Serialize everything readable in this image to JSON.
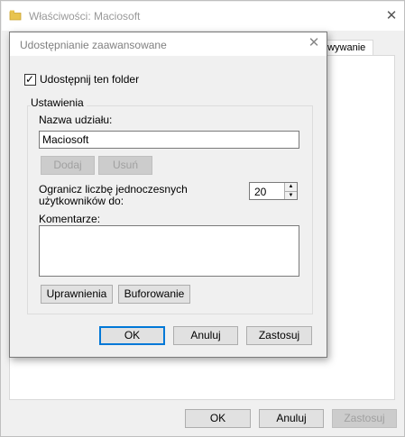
{
  "background_window": {
    "title": "Właściwości: Maciosoft",
    "tab_label": "owywanie",
    "buttons": {
      "ok": "OK",
      "cancel": "Anuluj",
      "apply": "Zastosuj"
    }
  },
  "dialog": {
    "title": "Udostępnianie zaawansowane",
    "share_checkbox": {
      "label": "Udostępnij ten folder",
      "checked": true
    },
    "settings_group": {
      "legend": "Ustawienia",
      "share_name_label": "Nazwa udziału:",
      "share_name_value": "Maciosoft",
      "add_button": "Dodaj",
      "remove_button": "Usuń",
      "limit_label": "Ogranicz liczbę jednoczesnych użytkowników do:",
      "limit_value": "20",
      "comments_label": "Komentarze:",
      "comments_value": "",
      "permissions_button": "Uprawnienia",
      "caching_button": "Buforowanie"
    },
    "buttons": {
      "ok": "OK",
      "cancel": "Anuluj",
      "apply": "Zastosuj"
    }
  },
  "icons": {
    "folder": "folder-icon",
    "close": "close-icon",
    "check": "checkmark-icon",
    "spin_up": "spin-up-arrow-icon",
    "spin_down": "spin-down-arrow-icon"
  },
  "colors": {
    "window_bg": "#f0f0f0",
    "focus_border": "#0078d7",
    "disabled_text": "#a0a0a0"
  }
}
